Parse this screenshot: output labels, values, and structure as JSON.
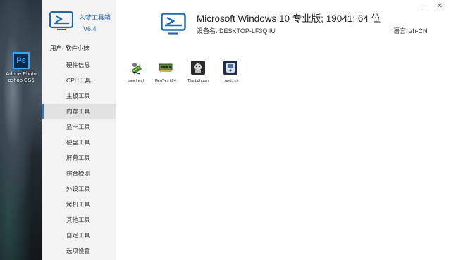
{
  "desktop": {
    "icon_label_line1": "Adobe Photo",
    "icon_label_line2": "oshop CS6",
    "icon_text": "Ps",
    "icon_name": "photoshop-icon"
  },
  "app": {
    "name": "入梦工具箱",
    "version": "V6.4",
    "user_label": "用户: 软件小妹",
    "accent_color": "#2a7ad0"
  },
  "window_controls": {
    "minimize": "—",
    "close": "✕"
  },
  "nav": [
    {
      "label": "硬件信息",
      "active": false
    },
    {
      "label": "CPU工具",
      "active": false
    },
    {
      "label": "主板工具",
      "active": false
    },
    {
      "label": "内存工具",
      "active": true
    },
    {
      "label": "显卡工具",
      "active": false
    },
    {
      "label": "硬盘工具",
      "active": false
    },
    {
      "label": "屏幕工具",
      "active": false
    },
    {
      "label": "综合检测",
      "active": false
    },
    {
      "label": "外设工具",
      "active": false
    },
    {
      "label": "烤机工具",
      "active": false
    },
    {
      "label": "其他工具",
      "active": false
    },
    {
      "label": "自定工具",
      "active": false
    },
    {
      "label": "选项设置",
      "active": false
    }
  ],
  "header": {
    "os_title": "Microsoft Windows 10 专业版; 19041; 64 位",
    "device_name": "设备名: DESKTOP-LF3QIIU",
    "language": "语言: zh-CN"
  },
  "tools": [
    {
      "label": "memtest",
      "icon": "memtest-icon"
    },
    {
      "label": "MemTest64",
      "icon": "ram-module-icon"
    },
    {
      "label": "Thaiphoon",
      "icon": "thaiphoon-icon"
    },
    {
      "label": "ramdisk",
      "icon": "ramdisk-icon"
    }
  ]
}
